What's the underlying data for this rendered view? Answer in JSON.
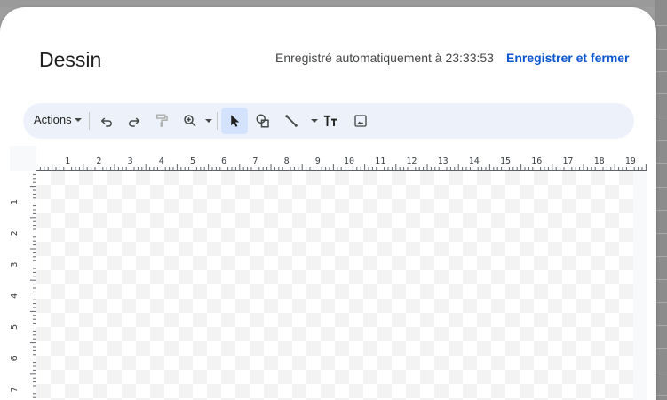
{
  "dialog": {
    "title": "Dessin",
    "autosave_status": "Enregistré automatiquement à 23:33:53",
    "save_close_label": "Enregistrer et fermer"
  },
  "toolbar": {
    "actions_label": "Actions",
    "buttons": [
      {
        "icon": "undo-icon"
      },
      {
        "icon": "redo-icon"
      },
      {
        "icon": "paint-format-icon"
      },
      {
        "icon": "zoom-icon"
      },
      {
        "icon": "select-cursor-icon",
        "active": true
      },
      {
        "icon": "shape-icon"
      },
      {
        "icon": "line-icon"
      },
      {
        "icon": "text-box-icon"
      },
      {
        "icon": "image-icon"
      }
    ]
  },
  "rulers": {
    "horizontal_labels": [
      "1",
      "2",
      "3",
      "4",
      "5",
      "6",
      "7",
      "8",
      "9",
      "10",
      "11",
      "12",
      "13",
      "14",
      "15",
      "16",
      "17",
      "18",
      "19"
    ],
    "vertical_labels": [
      "1",
      "2",
      "3",
      "4",
      "5",
      "6",
      "7"
    ]
  },
  "colors": {
    "accent": "#0b57d0",
    "toolbar_bg": "#edf2fa",
    "active_tool_bg": "#d3e3fd"
  }
}
